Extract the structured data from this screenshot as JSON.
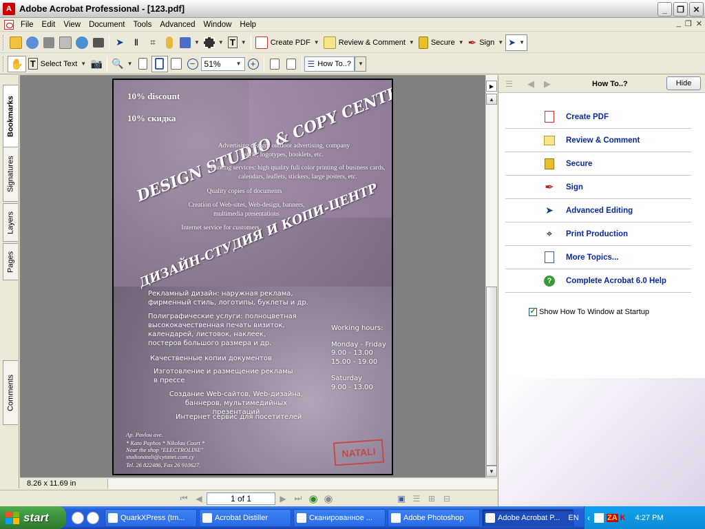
{
  "window": {
    "title": "Adobe Acrobat Professional - [123.pdf]",
    "app_icon": "acrobat-icon"
  },
  "menubar": {
    "items": [
      "File",
      "Edit",
      "View",
      "Document",
      "Tools",
      "Advanced",
      "Window",
      "Help"
    ]
  },
  "toolbar1": {
    "create_pdf": "Create PDF",
    "review_comment": "Review & Comment",
    "secure": "Secure",
    "sign": "Sign"
  },
  "toolbar2": {
    "select_text": "Select Text",
    "zoom": "51%",
    "how_to": "How To..?"
  },
  "left_tabs": [
    "Bookmarks",
    "Signatures",
    "Layers",
    "Pages",
    "Comments"
  ],
  "document": {
    "discount1": "10% discount",
    "discount2": "10% скидка",
    "studio_en": "DESIGN STUDIO & COPY CENTER",
    "svc1": "Advertising dezign: outdoor advertising, company style, logotypes, booklets, etc.",
    "svc2": "Printing services: high quality full color printing of business cards, calendars, leaflets, stickers, large posters, etc.",
    "svc3": "Quality copies of documents",
    "svc4": "Creation of Web-sites, Web-design, banners, multimedia presentations",
    "svc5": "Internet service for customers",
    "studio_ru": "ДИЗАЙН-СТУДИЯ И КОПИ-ЦЕНТР",
    "ru1": "Рекламный дизайн: наружная реклама, фирменный стиль, логотипы, буклеты и др.",
    "ru2": "Полиграфические услуги: полноцветная высококачественная печать визиток, календарей, листовок, наклеек, постеров большого размера и др.",
    "ru3": "Качественные копии документов",
    "ru4": "Изготовление и размещение рекламы в прессе",
    "ru5": "Создание Web-сайтов, Web-дизайна, баннеров, мультимедийных презентаций",
    "ru6": "Интернет сервис для посетителей",
    "hours_title": "Working hours:",
    "hours_days1": "Monday - Friday",
    "hours_t1": "9.00 - 13.00",
    "hours_t2": "15.00 - 19.00",
    "hours_days2": "Saturday",
    "hours_t3": "9.00 - 13.00",
    "addr1": "Ap. Pavlou ave.",
    "addr2": "* Kato Paphos * Nikolau Court *",
    "addr3": "Near the shop \"ELECTROLINE\"",
    "addr4": "studionatali@cytanet.com.cy",
    "addr5": "Tel. 26 822486, Fax 26 910627.",
    "logo_text": "NATALI"
  },
  "status": {
    "page_size": "8.26 x 11.69 in",
    "page_of": "1 of 1"
  },
  "right_panel": {
    "title": "How To..?",
    "hide": "Hide",
    "topics": [
      {
        "label": "Create PDF",
        "icon": "create-pdf-icon"
      },
      {
        "label": "Review & Comment",
        "icon": "review-comment-icon"
      },
      {
        "label": "Secure",
        "icon": "lock-icon"
      },
      {
        "label": "Sign",
        "icon": "pen-icon"
      },
      {
        "label": "Advanced Editing",
        "icon": "advanced-editing-icon"
      },
      {
        "label": "Print Production",
        "icon": "print-production-icon"
      },
      {
        "label": "More Topics...",
        "icon": "more-topics-icon"
      },
      {
        "label": "Complete Acrobat 6.0 Help",
        "icon": "help-icon"
      }
    ],
    "startup_label": "Show How To Window at Startup",
    "startup_checked": true
  },
  "taskbar": {
    "start": "start",
    "tasks": [
      "QuarkXPress (tm...",
      "Acrobat Distiller",
      "Сканированное ...",
      "Adobe Photoshop",
      "Adobe Acrobat P..."
    ],
    "lang": "EN",
    "clock": "4:27 PM"
  }
}
